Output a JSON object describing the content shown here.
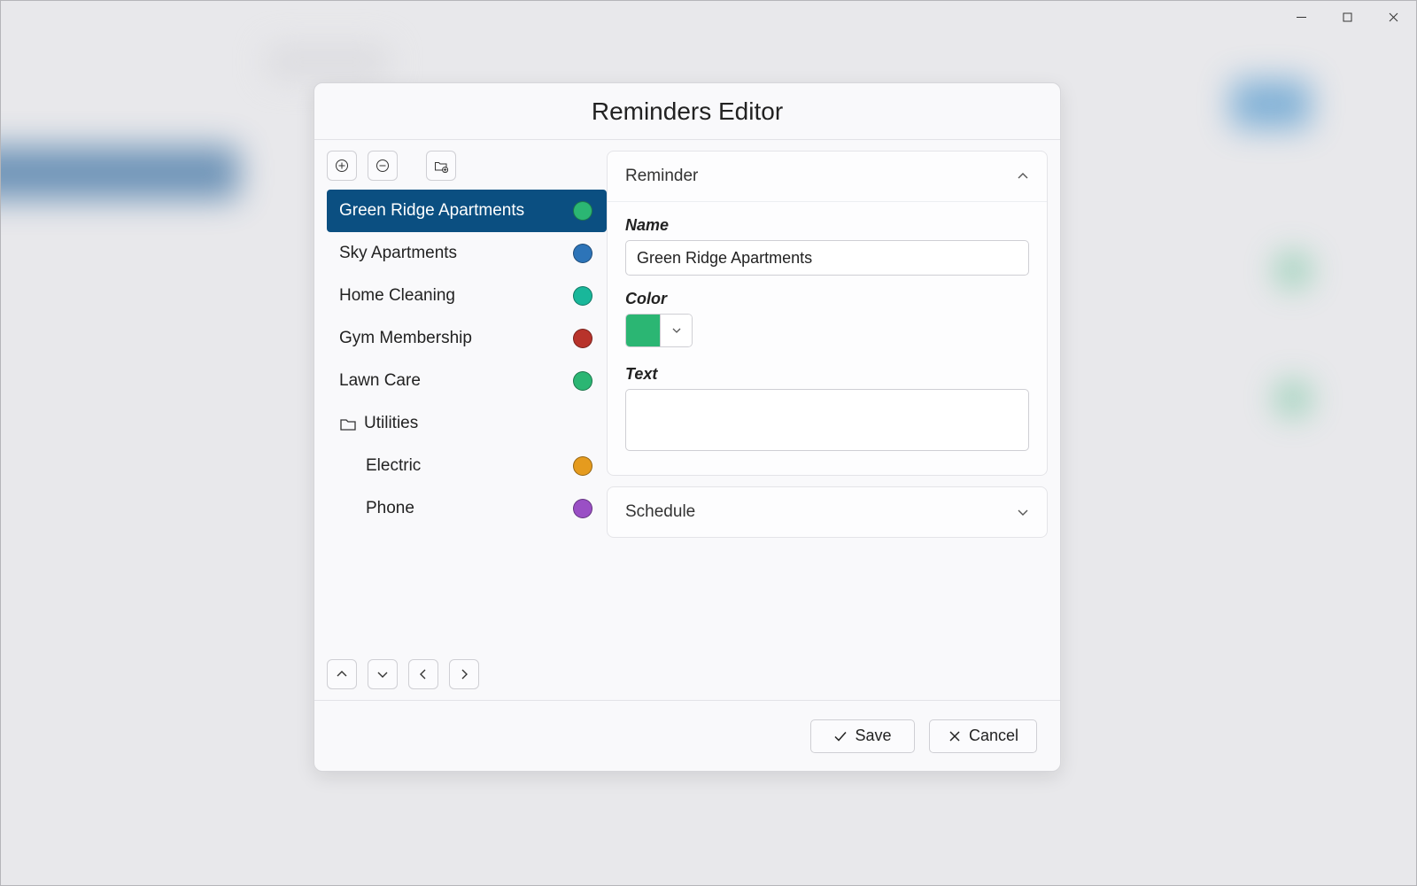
{
  "dialog": {
    "title": "Reminders Editor",
    "save_label": "Save",
    "cancel_label": "Cancel"
  },
  "panels": {
    "reminder": {
      "title": "Reminder",
      "expanded": true
    },
    "schedule": {
      "title": "Schedule",
      "expanded": false
    }
  },
  "form": {
    "name_label": "Name",
    "name_value": "Green Ridge Apartments",
    "color_label": "Color",
    "color_value": "#2bb673",
    "text_label": "Text",
    "text_value": ""
  },
  "reminders": [
    {
      "label": "Green Ridge Apartments",
      "color": "#2bb673",
      "selected": true,
      "type": "item",
      "depth": 0
    },
    {
      "label": "Sky Apartments",
      "color": "#2d74b8",
      "selected": false,
      "type": "item",
      "depth": 0
    },
    {
      "label": "Home Cleaning",
      "color": "#19b79a",
      "selected": false,
      "type": "item",
      "depth": 0
    },
    {
      "label": "Gym Membership",
      "color": "#b8332b",
      "selected": false,
      "type": "item",
      "depth": 0
    },
    {
      "label": "Lawn Care",
      "color": "#2bb673",
      "selected": false,
      "type": "item",
      "depth": 0
    },
    {
      "label": "Utilities",
      "color": null,
      "selected": false,
      "type": "folder",
      "depth": 0
    },
    {
      "label": "Electric",
      "color": "#e59b1e",
      "selected": false,
      "type": "item",
      "depth": 1
    },
    {
      "label": "Phone",
      "color": "#9a4fc5",
      "selected": false,
      "type": "item",
      "depth": 1
    }
  ]
}
